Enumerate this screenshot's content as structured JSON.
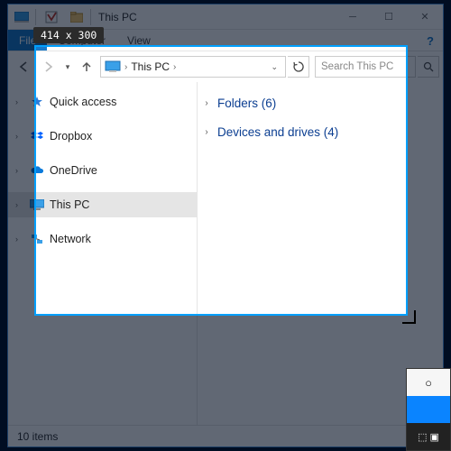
{
  "titlebar": {
    "title": "This PC"
  },
  "menubar": {
    "file": "File",
    "computer": "Computer",
    "view": "View"
  },
  "addressbar": {
    "location": "This PC",
    "search_placeholder": "Search This PC"
  },
  "nav": {
    "items": [
      {
        "label": "Quick access",
        "icon": "star"
      },
      {
        "label": "Dropbox",
        "icon": "dropbox"
      },
      {
        "label": "OneDrive",
        "icon": "cloud"
      },
      {
        "label": "This PC",
        "icon": "monitor",
        "selected": true
      },
      {
        "label": "Network",
        "icon": "network"
      }
    ]
  },
  "content": {
    "groups": [
      {
        "label": "Folders (6)"
      },
      {
        "label": "Devices and drives (4)"
      }
    ]
  },
  "status": {
    "text": "10 items"
  },
  "capture": {
    "dimensions": "414 x 300"
  }
}
